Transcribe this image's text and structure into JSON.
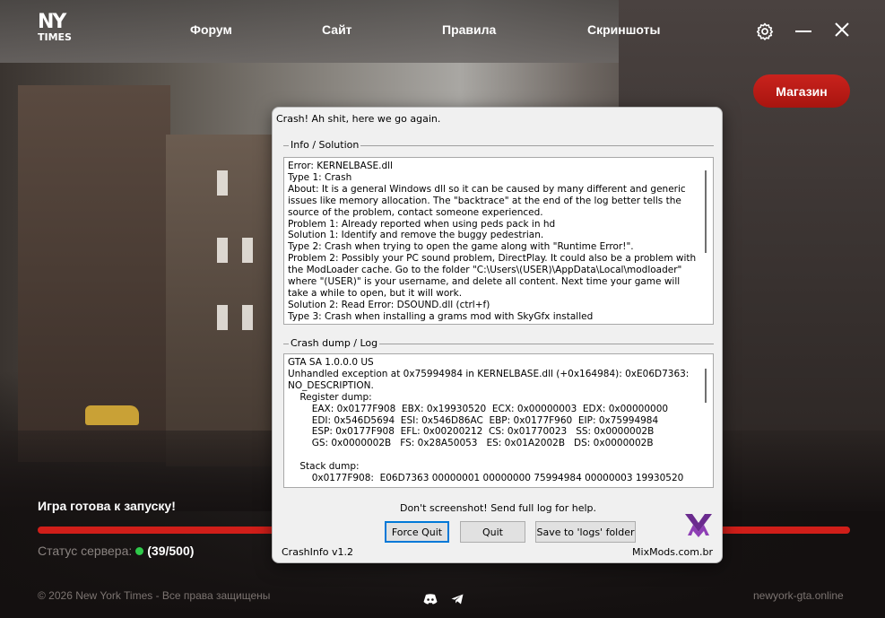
{
  "launcher": {
    "logo": {
      "line1": "NY",
      "line2": "TIMES"
    },
    "nav": [
      {
        "label": "Форум"
      },
      {
        "label": "Сайт"
      },
      {
        "label": "Правила"
      },
      {
        "label": "Скриншоты"
      }
    ],
    "icons": {
      "settings": "gear-icon",
      "minimize": "minimize-icon",
      "close": "close-icon"
    },
    "shop_button": "Магазин",
    "status_title": "Игра готова к запуску!",
    "progress_percent": 100,
    "server_status_label": "Статус сервера:",
    "server_count": "(39/500)",
    "footer_copyright": "© 2026 New York Times - Все права защищены",
    "footer_site": "newyork-gta.online",
    "colors": {
      "accent": "#d01e19",
      "online": "#2fc94a"
    }
  },
  "crash_dialog": {
    "title": "Crash! Ah shit, here we go again.",
    "info_group_label": "Info / Solution",
    "info_text": "Error: KERNELBASE.dll\nType 1: Crash\nAbout: It is a general Windows dll so it can be caused by many different and generic issues like memory allocation. The \"backtrace\" at the end of the log better tells the source of the problem, contact someone experienced.\nProblem 1: Already reported when using peds pack in hd\nSolution 1: Identify and remove the buggy pedestrian.\nType 2: Crash when trying to open the game along with \"Runtime Error!\".\nProblem 2: Possibly your PC sound problem, DirectPlay. It could also be a problem with the ModLoader cache. Go to the folder \"C:\\Users\\(USER)\\AppData\\Local\\modloader\" where \"(USER)\" is your username, and delete all content. Next time your game will take a while to open, but it will work.\nSolution 2: Read Error: DSOUND.dll (ctrl+f)\nType 3: Crash when installing a grams mod with SkyGfx installed",
    "log_group_label": "Crash dump / Log",
    "log_text": "GTA SA 1.0.0.0 US\nUnhandled exception at 0x75994984 in KERNELBASE.dll (+0x164984): 0xE06D7363: NO_DESCRIPTION.\n    Register dump:\n        EAX: 0x0177F908  EBX: 0x19930520  ECX: 0x00000003  EDX: 0x00000000\n        EDI: 0x546D5694  ESI: 0x546D86AC  EBP: 0x0177F960  EIP: 0x75994984\n        ESP: 0x0177F908  EFL: 0x00200212  CS: 0x01770023   SS: 0x0000002B\n        GS: 0x0000002B   FS: 0x28A50053   ES: 0x01A2002B   DS: 0x0000002B\n\n    Stack dump:\n        0x0177F908:  E06D7363 00000001 00000000 75994984 00000003 19930520",
    "hint": "Don't screenshot! Send full log for help.",
    "buttons": {
      "force_quit": "Force Quit",
      "quit": "Quit",
      "save_logs": "Save to 'logs' folder"
    },
    "version": "CrashInfo v1.2",
    "site": "MixMods.com.br"
  }
}
